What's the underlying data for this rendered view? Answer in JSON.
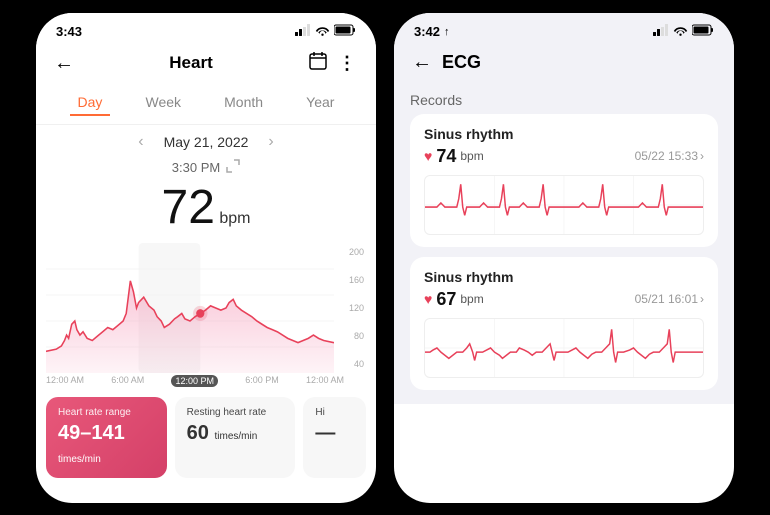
{
  "left_screen": {
    "status_bar": {
      "time": "3:43",
      "signal": "▂▄",
      "wifi": "WiFi",
      "battery": "🔋"
    },
    "nav": {
      "title": "Heart",
      "back_label": "←",
      "calendar_icon": "calendar",
      "more_icon": "more"
    },
    "tabs": [
      {
        "label": "Day",
        "active": true
      },
      {
        "label": "Week",
        "active": false
      },
      {
        "label": "Month",
        "active": false
      },
      {
        "label": "Year",
        "active": false
      }
    ],
    "date": "May 21, 2022",
    "time_reading": "3:30 PM",
    "heart_rate_value": "72",
    "heart_rate_unit": "bpm",
    "chart": {
      "y_labels": [
        "200",
        "160",
        "120",
        "80",
        "40"
      ],
      "x_labels": [
        "12:00 AM",
        "6:00 AM",
        "12:00 PM",
        "6:00 PM",
        "12:00 AM"
      ]
    },
    "stats": [
      {
        "label": "Heart rate range",
        "value": "49–141",
        "unit": "times/min",
        "type": "pink"
      },
      {
        "label": "Resting heart rate",
        "value": "60",
        "unit": "times/min",
        "type": "white"
      },
      {
        "label": "Hi",
        "value": "—",
        "unit": "",
        "type": "white"
      }
    ]
  },
  "right_screen": {
    "status_bar": {
      "time": "3:42",
      "location": "↑",
      "signal": "▂▄",
      "wifi": "WiFi",
      "battery": "🔋"
    },
    "nav": {
      "back_label": "←",
      "title": "ECG"
    },
    "records_label": "Records",
    "ecg_records": [
      {
        "rhythm": "Sinus rhythm",
        "bpm": "74",
        "bpm_unit": "bpm",
        "timestamp": "05/22 15:33",
        "has_arrow": true
      },
      {
        "rhythm": "Sinus rhythm",
        "bpm": "67",
        "bpm_unit": "bpm",
        "timestamp": "05/21 16:01",
        "has_arrow": true
      }
    ]
  }
}
